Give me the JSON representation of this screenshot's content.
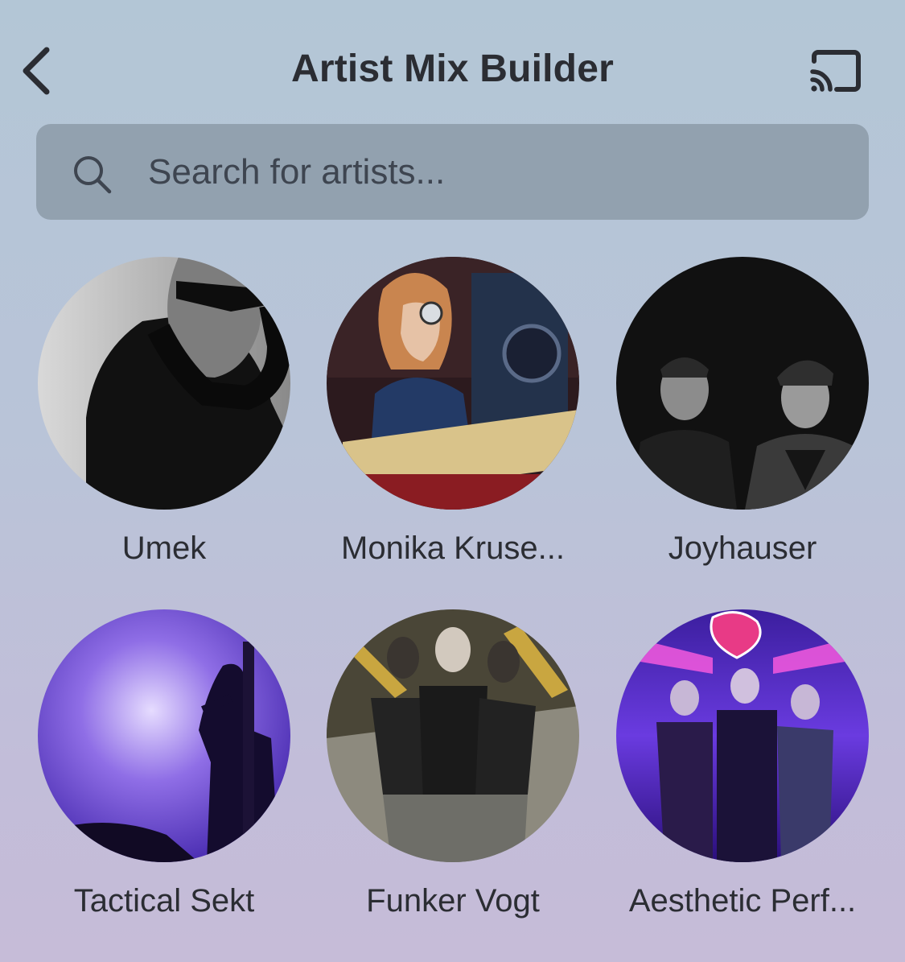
{
  "header": {
    "title": "Artist Mix Builder",
    "back_icon": "chevron-left-icon",
    "cast_icon": "cast-icon"
  },
  "search": {
    "placeholder": "Search for artists...",
    "value": "",
    "icon": "search-icon"
  },
  "artists": [
    {
      "name": "Umek"
    },
    {
      "name": "Monika Kruse..."
    },
    {
      "name": "Joyhauser"
    },
    {
      "name": "Tactical Sekt"
    },
    {
      "name": "Funker Vogt"
    },
    {
      "name": "Aesthetic Perf..."
    }
  ]
}
